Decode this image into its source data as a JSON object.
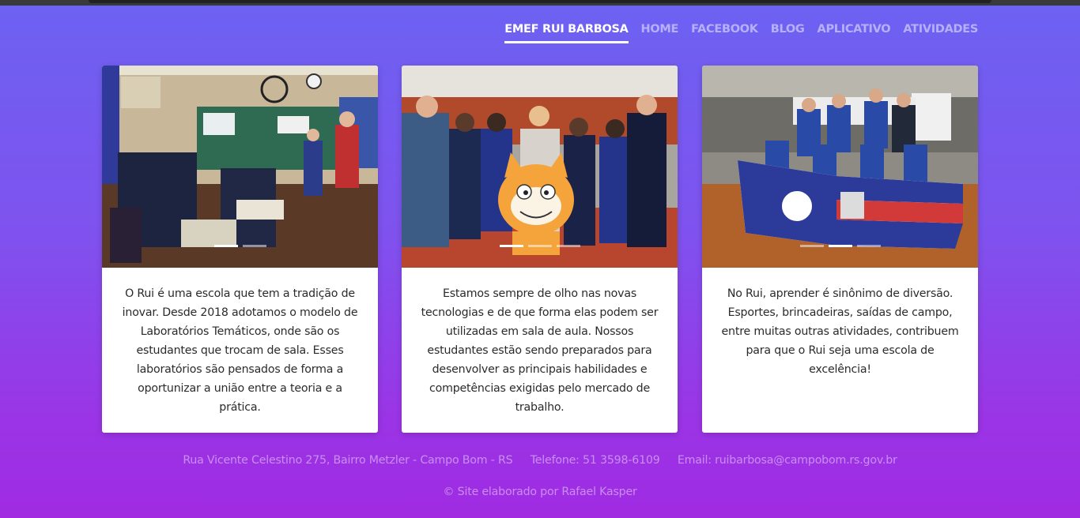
{
  "nav": {
    "items": [
      {
        "label": "EMEF RUI BARBOSA",
        "active": true
      },
      {
        "label": "HOME",
        "active": false
      },
      {
        "label": "FACEBOOK",
        "active": false
      },
      {
        "label": "BLOG",
        "active": false
      },
      {
        "label": "APLICATIVO",
        "active": false
      },
      {
        "label": "ATIVIDADES",
        "active": false
      }
    ]
  },
  "cards": [
    {
      "photo": "classroom-photo",
      "slides": 2,
      "active_slide": 1,
      "text": "O Rui é uma escola que tem a tradição de inovar. Desde 2018 adotamos o modelo de Laboratórios Temáticos, onde são os estudantes que trocam de sala. Esses laboratórios são pensados de forma a oportunizar a união entre a teoria e a prática."
    },
    {
      "photo": "scratch-group-photo",
      "slides": 3,
      "active_slide": 1,
      "text": "Estamos sempre de olho nas novas tecnologias e de que forma elas podem ser utilizadas em sala de aula. Nossos estudantes estão sendo preparados para desenvolver as principais habilidades e competências exigidas pelo mercado de trabalho."
    },
    {
      "photo": "sports-team-photo",
      "slides": 3,
      "active_slide": 2,
      "text": "No Rui, aprender é sinônimo de diversão. Esportes, brincadeiras, saídas de campo, entre muitas outras atividades, contribuem para que o Rui seja uma escola de excelência!"
    }
  ],
  "footer": {
    "address": "Rua Vicente Celestino 275, Bairro Metzler - Campo Bom - RS",
    "phone": "Telefone: 51 3598-6109",
    "email": "Email: ruibarbosa@campobom.rs.gov.br",
    "credit": "© Site elaborado por Rafael Kasper"
  },
  "colors": {
    "background_top": "#6c62f2",
    "background_bottom": "#a02be2",
    "card": "#ffffff"
  }
}
